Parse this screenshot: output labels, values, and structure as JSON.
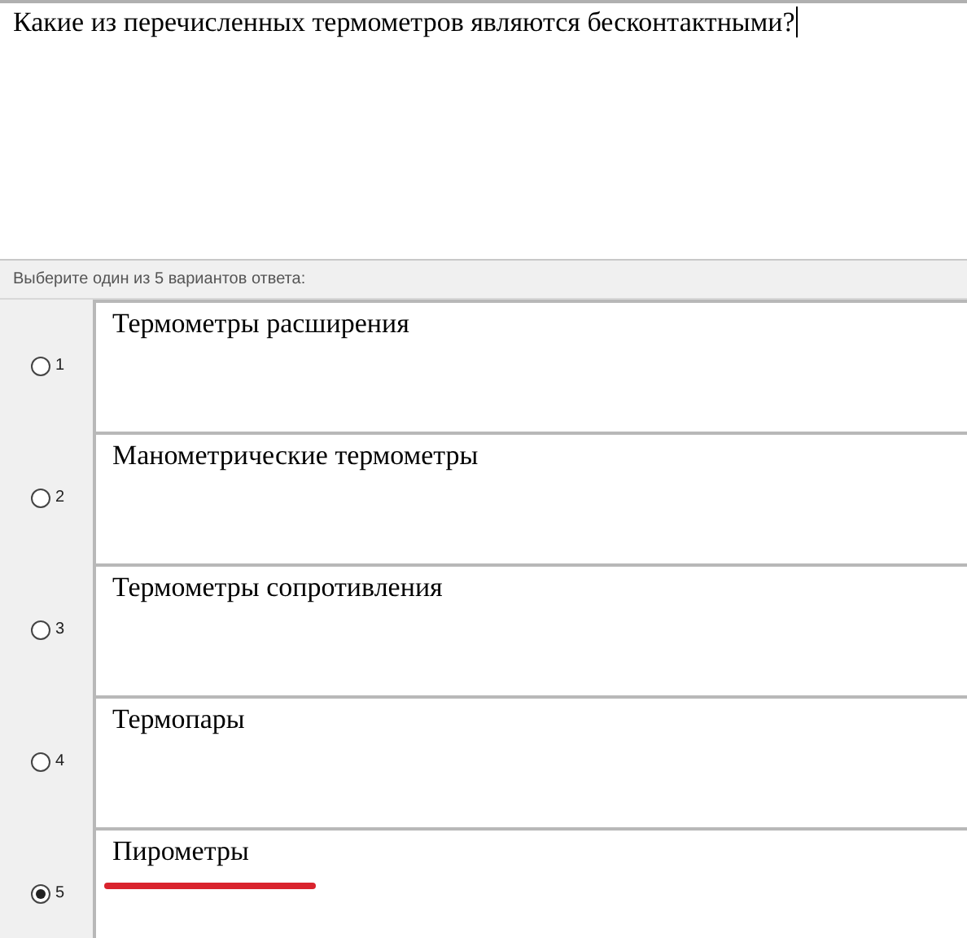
{
  "question": {
    "text": "Какие из перечисленных термометров являются бесконтактными?"
  },
  "instruction": "Выберите один из 5 вариантов ответа:",
  "options": [
    {
      "number": "1",
      "text": "Термометры расширения",
      "selected": false,
      "underlined": false
    },
    {
      "number": "2",
      "text": "Манометрические термометры",
      "selected": false,
      "underlined": false
    },
    {
      "number": "3",
      "text": "Термометры сопротивления",
      "selected": false,
      "underlined": false
    },
    {
      "number": "4",
      "text": "Термопары",
      "selected": false,
      "underlined": false
    },
    {
      "number": "5",
      "text": "Пирометры",
      "selected": true,
      "underlined": true
    }
  ]
}
